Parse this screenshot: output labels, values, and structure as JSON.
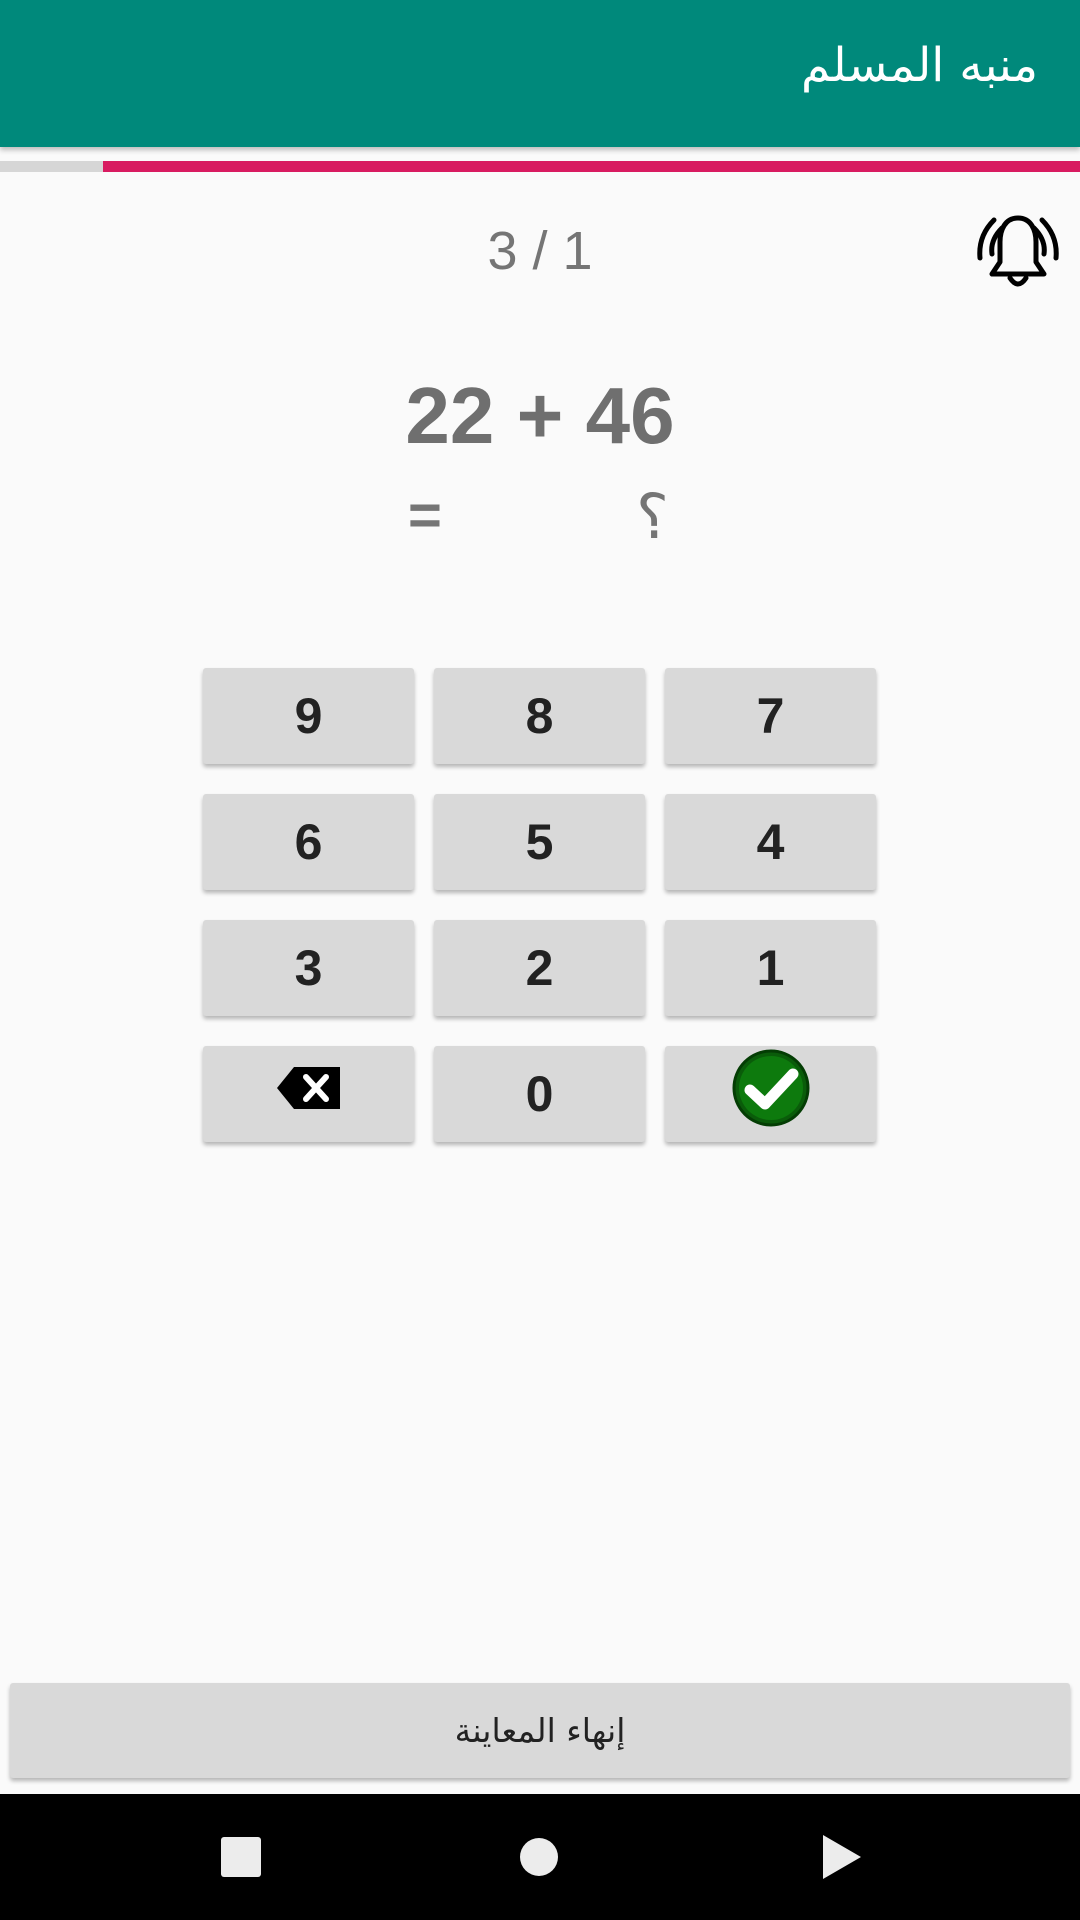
{
  "app_bar": {
    "title": "منبه المسلم",
    "color": "#00897b"
  },
  "progress": {
    "value_fraction": 0.905,
    "color": "#d81b60"
  },
  "question": {
    "counter": "3 / 1",
    "expression": "22 + 46",
    "equals": "=",
    "answer_placeholder": "؟"
  },
  "keypad": {
    "keys": [
      "9",
      "8",
      "7",
      "6",
      "5",
      "4",
      "3",
      "2",
      "1",
      "0"
    ],
    "delete_icon": "backspace-icon",
    "confirm_icon": "check-circle-icon"
  },
  "footer": {
    "finish_label": "إنهاء المعاينة"
  },
  "navigation": {
    "icons": [
      "recents-square-icon",
      "home-circle-icon",
      "back-triangle-icon"
    ]
  }
}
